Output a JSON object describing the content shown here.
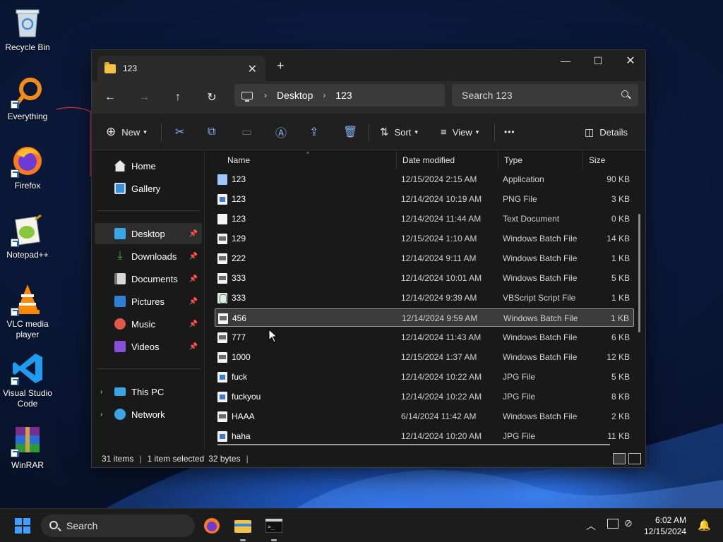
{
  "desktop": {
    "icons": [
      {
        "label": "Recycle Bin",
        "icon": "recycle-bin-icon"
      },
      {
        "label": "Everything",
        "icon": "everything-search-icon"
      },
      {
        "label": "Firefox",
        "icon": "firefox-icon"
      },
      {
        "label": "Notepad++",
        "icon": "notepad-plus-plus-icon"
      },
      {
        "label": "VLC media player",
        "icon": "vlc-icon"
      },
      {
        "label": "Visual Studio Code",
        "icon": "vscode-icon"
      },
      {
        "label": "WinRAR",
        "icon": "winrar-icon"
      }
    ]
  },
  "window": {
    "tab_title": "123",
    "new_tab": "+",
    "address": {
      "segments": [
        "Desktop",
        "123"
      ]
    },
    "search": {
      "placeholder": "Search 123"
    },
    "toolbar": {
      "new_label": "New",
      "sort_label": "Sort",
      "view_label": "View",
      "more_label": "•••",
      "details_label": "Details"
    },
    "nav": {
      "home": "Home",
      "gallery": "Gallery",
      "desktop": "Desktop",
      "downloads": "Downloads",
      "documents": "Documents",
      "pictures": "Pictures",
      "music": "Music",
      "videos": "Videos",
      "this_pc": "This PC",
      "network": "Network"
    },
    "columns": {
      "name": "Name",
      "date": "Date modified",
      "type": "Type",
      "size": "Size"
    },
    "files": [
      {
        "name": "123",
        "date": "12/15/2024 2:15 AM",
        "type": "Application",
        "size": "90 KB",
        "icon": "app"
      },
      {
        "name": "123",
        "date": "12/14/2024 10:19 AM",
        "type": "PNG File",
        "size": "3 KB",
        "icon": "img"
      },
      {
        "name": "123",
        "date": "12/14/2024 11:44 AM",
        "type": "Text Document",
        "size": "0 KB",
        "icon": "txt"
      },
      {
        "name": "129",
        "date": "12/15/2024 1:10 AM",
        "type": "Windows Batch File",
        "size": "14 KB",
        "icon": "bat"
      },
      {
        "name": "222",
        "date": "12/14/2024 9:11 AM",
        "type": "Windows Batch File",
        "size": "1 KB",
        "icon": "bat"
      },
      {
        "name": "333",
        "date": "12/14/2024 10:01 AM",
        "type": "Windows Batch File",
        "size": "5 KB",
        "icon": "bat"
      },
      {
        "name": "333",
        "date": "12/14/2024 9:39 AM",
        "type": "VBScript Script File",
        "size": "1 KB",
        "icon": "vbs"
      },
      {
        "name": "456",
        "date": "12/14/2024 9:59 AM",
        "type": "Windows Batch File",
        "size": "1 KB",
        "icon": "bat",
        "selected": true
      },
      {
        "name": "777",
        "date": "12/14/2024 11:43 AM",
        "type": "Windows Batch File",
        "size": "6 KB",
        "icon": "bat"
      },
      {
        "name": "1000",
        "date": "12/15/2024 1:37 AM",
        "type": "Windows Batch File",
        "size": "12 KB",
        "icon": "bat"
      },
      {
        "name": "fuck",
        "date": "12/14/2024 10:22 AM",
        "type": "JPG File",
        "size": "5 KB",
        "icon": "img"
      },
      {
        "name": "fuckyou",
        "date": "12/14/2024 10:22 AM",
        "type": "JPG File",
        "size": "8 KB",
        "icon": "img"
      },
      {
        "name": "HAAA",
        "date": "6/14/2024 11:42 AM",
        "type": "Windows Batch File",
        "size": "2 KB",
        "icon": "bat"
      },
      {
        "name": "haha",
        "date": "12/14/2024 10:20 AM",
        "type": "JPG File",
        "size": "11 KB",
        "icon": "img"
      }
    ],
    "status": {
      "items": "31 items",
      "selected": "1 item selected",
      "size": "32 bytes"
    }
  },
  "taskbar": {
    "search_label": "Search",
    "time": "6:02 AM",
    "date": "12/15/2024"
  },
  "colors": {
    "accent": "#0078d4",
    "window_bg": "#191919",
    "selected_row": "#3b3b3b"
  }
}
